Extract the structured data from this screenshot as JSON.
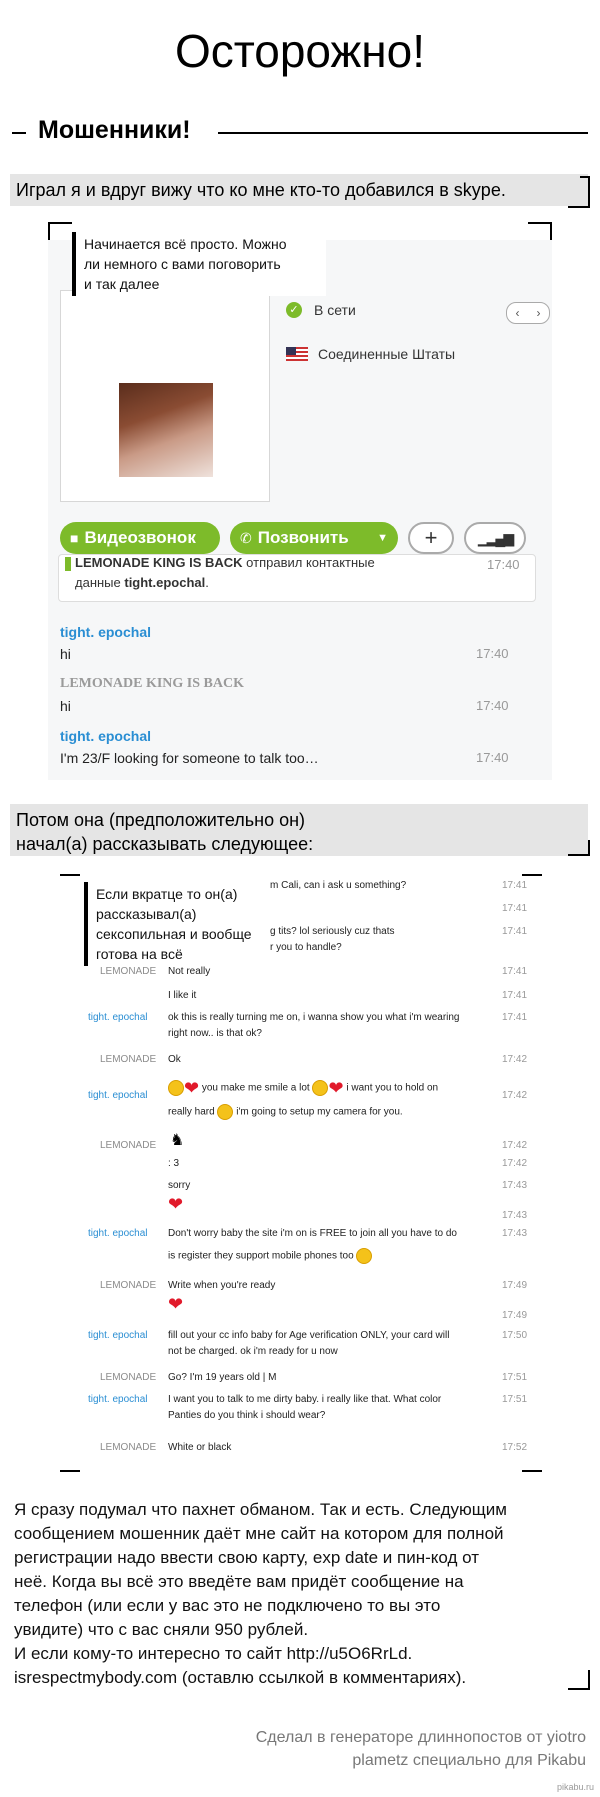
{
  "title": "Осторожно!",
  "heading": "Мошенники!",
  "caption1": "Играл я и вдруг вижу что ко мне кто-то добавился в skype.",
  "note1": [
    "Начинается всё просто. Можно",
    "ли немного с вами поговорить",
    "и так далее"
  ],
  "profile": {
    "status": "В сети",
    "country": "Соединенные Штаты",
    "video_button": "Видеозвонок",
    "call_button": "Позвонить",
    "add_icon": "plus-icon",
    "signal_icon": "signal-icon"
  },
  "chat1": {
    "notice_sender": "LEMONADE KING IS BACK",
    "notice_mid": " отправил контактные",
    "notice_line2": "данные ",
    "notice_contact": "tight.epochal",
    "notice_end": ".",
    "notice_time": "17:40",
    "messages": [
      {
        "name": "tight. epochal",
        "text": "hi",
        "time": "17:40",
        "kind": "blue"
      },
      {
        "name": "LEMONADE KING IS BACK",
        "text": "hi",
        "time": "17:40",
        "kind": "grey"
      },
      {
        "name": "tight. epochal",
        "text": "I'm 23/F looking for someone to talk too…",
        "time": "17:40",
        "kind": "blue"
      }
    ]
  },
  "caption2": [
    "Потом она (предположительно он)",
    "начал(а) рассказывать следующее:"
  ],
  "note2": [
    "Если вкратце то он(а)",
    "рассказывал(а)",
    "сексопильная и вообще",
    "готова на всё"
  ],
  "chat2": {
    "partial": [
      {
        "text": "m Cali, can i ask u something?",
        "time": "17:41"
      },
      {
        "text": "",
        "time": "17:41"
      },
      {
        "text": "g tits? lol seriously cuz thats",
        "time": "17:41"
      },
      {
        "text": "r you to handle?",
        "time": ""
      }
    ],
    "rows": [
      {
        "name": "LEMONADE",
        "lines": [
          "Not really"
        ],
        "time": "17:41",
        "kind": "grey"
      },
      {
        "name": "",
        "lines": [
          "I like it"
        ],
        "time": "17:41",
        "kind": "grey"
      },
      {
        "name": "tight. epochal",
        "lines": [
          "ok this is really turning me on, i wanna show you what i'm wearing",
          "right now.. is that ok?"
        ],
        "time": "17:41",
        "kind": "blue"
      },
      {
        "name": "LEMONADE",
        "lines": [
          "Ok"
        ],
        "time": "17:42",
        "kind": "grey"
      },
      {
        "name": "tight. epochal",
        "lines": [
          "you make me smile a lot",
          "i want you to hold on",
          "really hard",
          "i'm going to setup my camera for you."
        ],
        "time": "17:42",
        "kind": "blue"
      },
      {
        "name": "LEMONADE",
        "lines": [
          ""
        ],
        "time": "17:42",
        "kind": "grey"
      },
      {
        "name": "",
        "lines": [
          ": 3"
        ],
        "time": "17:42",
        "kind": "grey"
      },
      {
        "name": "",
        "lines": [
          "sorry"
        ],
        "time": "17:43",
        "kind": "grey"
      },
      {
        "name": "",
        "lines": [
          ""
        ],
        "time": "17:43",
        "kind": "grey"
      },
      {
        "name": "tight. epochal",
        "lines": [
          "Don't worry baby the site i'm on is FREE to join all you have to do",
          "is register they support mobile phones too"
        ],
        "time": "17:43",
        "kind": "blue"
      },
      {
        "name": "LEMONADE",
        "lines": [
          "Write when you're ready"
        ],
        "time": "17:49",
        "kind": "grey"
      },
      {
        "name": "",
        "lines": [
          ""
        ],
        "time": "17:49",
        "kind": "grey"
      },
      {
        "name": "tight. epochal",
        "lines": [
          "fill out your cc info baby for Age verification ONLY, your card will",
          "not be charged. ok i'm ready for u now"
        ],
        "time": "17:50",
        "kind": "blue"
      },
      {
        "name": "LEMONADE",
        "lines": [
          "Go? I'm 19 years old | M"
        ],
        "time": "17:51",
        "kind": "grey"
      },
      {
        "name": "tight. epochal",
        "lines": [
          "I want you to talk to me dirty baby. i really like that. What color",
          "Panties do you think i should wear?"
        ],
        "time": "17:51",
        "kind": "blue"
      },
      {
        "name": "LEMONADE",
        "lines": [
          "White or black"
        ],
        "time": "17:52",
        "kind": "grey"
      }
    ]
  },
  "paragraph": [
    "Я сразу подумал что пахнет обманом. Так и есть. Следующим",
    " сообщением мошенник даёт мне сайт на котором для полной",
    " регистрации надо ввести свою карту, exp date и пин-код от",
    " неё. Когда вы всё это введёте вам придёт сообщение на",
    " телефон (или если у вас это не подключено то вы это",
    " увидите) что с вас сняли 950 рублей.",
    "И если кому-то интересно то сайт http://u5O6RrLd.",
    "isrespectmybody.com (оставлю ссылкой в комментариях)."
  ],
  "footer": [
    "Сделал в генераторе длиннопостов от yiotro",
    "plametz специально для Pikabu"
  ],
  "watermark": "pikabu.ru"
}
